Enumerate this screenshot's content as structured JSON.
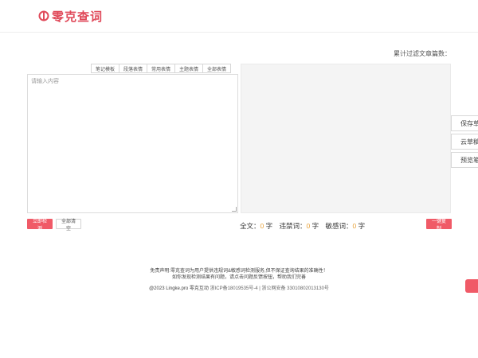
{
  "header": {
    "logo_text": "零克查词",
    "brand_color": "#e04a5a"
  },
  "counter": {
    "label": "累计过滤文章篇数："
  },
  "toolbar": {
    "buttons": [
      "笔记模板",
      "段落表情",
      "常用表情",
      "主题表情",
      "全部表情"
    ]
  },
  "editor": {
    "value": "",
    "placeholder": "请输入内容"
  },
  "actions": {
    "detect_label": "立即检测",
    "clear_label": "全部清空",
    "copy_label": "一键复制",
    "accent_color": "#f05a67"
  },
  "stats": {
    "full_label": "全文：",
    "full_count": "0",
    "banned_label": "违禁词：",
    "banned_count": "0",
    "sensitive_label": "敏感词：",
    "sensitive_count": "0",
    "unit": "字"
  },
  "side_buttons": [
    "保存草稿",
    "云草稿",
    "预览笔记"
  ],
  "footer": {
    "line1": "免责声明:零克查词为用户提供违规词&敏感词检测服务,但不保证查询结果的准确性！",
    "line2": "如你发现检测结果有问题，请点击问题反馈按钮，帮助我们完善",
    "copyright": "@2023 Lingke.pro 零克互动",
    "icp": "浙ICP备18019535号-4",
    "separator": "|",
    "police": "浙公网安备 33010802013130号"
  }
}
